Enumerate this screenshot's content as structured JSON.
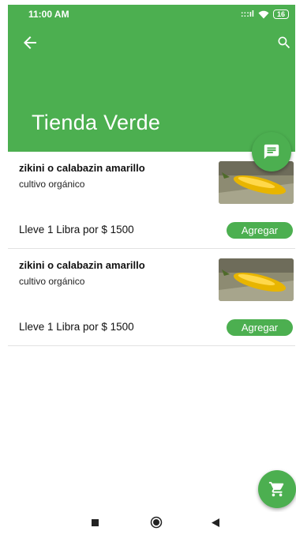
{
  "status": {
    "time": "11:00 AM",
    "signal": ":::ıl",
    "battery": "16"
  },
  "appbar": {
    "title": "Tienda Verde"
  },
  "products": [
    {
      "name": "zikini o calabazin amarillo",
      "description": "cultivo orgánico",
      "offer": "Lleve 1 Libra por $ 1500",
      "button": "Agregar"
    },
    {
      "name": "zikini o calabazin amarillo",
      "description": "cultivo orgánico",
      "offer": "Lleve 1 Libra por $ 1500",
      "button": "Agregar"
    }
  ],
  "colors": {
    "primary": "#4caf50",
    "divider": "#e2e2e2"
  },
  "icons": {
    "back": "arrow-back-icon",
    "search": "search-icon",
    "chat": "chat-icon",
    "cart": "shopping-cart-icon"
  }
}
